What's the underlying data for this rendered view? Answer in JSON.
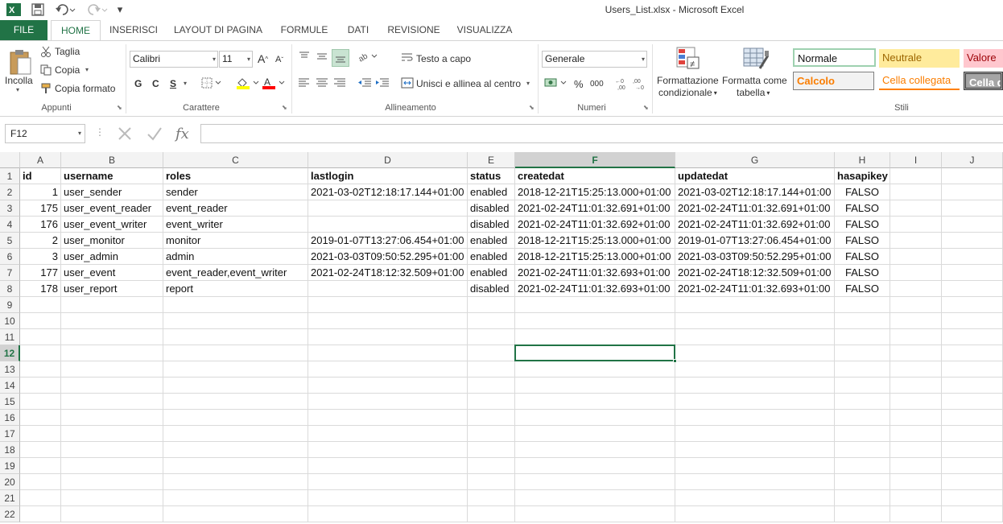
{
  "window": {
    "title": "Users_List.xlsx - Microsoft Excel"
  },
  "quick_access": {
    "more": "▾"
  },
  "tabs": [
    "FILE",
    "HOME",
    "INSERISCI",
    "LAYOUT DI PAGINA",
    "FORMULE",
    "DATI",
    "REVISIONE",
    "VISUALIZZA"
  ],
  "ribbon": {
    "clipboard": {
      "paste": "Incolla",
      "cut": "Taglia",
      "copy": "Copia",
      "format_painter": "Copia formato",
      "label": "Appunti"
    },
    "font": {
      "name": "Calibri",
      "size": "11",
      "bold": "G",
      "italic": "C",
      "underline": "S",
      "grow": "A",
      "shrink": "A",
      "label": "Carattere"
    },
    "alignment": {
      "wrap": "Testo a capo",
      "merge": "Unisci e allinea al centro",
      "label": "Allineamento"
    },
    "number": {
      "format": "Generale",
      "percent": "%",
      "thousands": "000",
      "label": "Numeri"
    },
    "styles": {
      "conditional_1": "Formattazione",
      "conditional_2": "condizionale",
      "table_1": "Formatta come",
      "table_2": "tabella",
      "normal": "Normale",
      "neutral": "Neutrale",
      "value": "Valore",
      "calc": "Calcolo",
      "linked": "Cella collegata",
      "check": "Cella da",
      "label": "Stili"
    }
  },
  "formula_bar": {
    "name_box": "F12",
    "fx": "fx",
    "value": ""
  },
  "sheet": {
    "columns": [
      "A",
      "B",
      "C",
      "D",
      "E",
      "F",
      "G",
      "H",
      "I",
      "J"
    ],
    "selected_column": "F",
    "selected_row": 12,
    "row_numbers": [
      "1",
      "2",
      "3",
      "4",
      "5",
      "6",
      "7",
      "8",
      "9",
      "10",
      "11",
      "12",
      "13",
      "14",
      "15",
      "16",
      "17",
      "18",
      "19",
      "20",
      "21",
      "22"
    ],
    "header": [
      "id",
      "username",
      "roles",
      "lastlogin",
      "status",
      "createdat",
      "updatedat",
      "hasapikey"
    ],
    "rows": [
      [
        "1",
        "user_sender",
        "sender",
        "2021-03-02T12:18:17.144+01:00",
        "enabled",
        "2018-12-21T15:25:13.000+01:00",
        "2021-03-02T12:18:17.144+01:00",
        "FALSO"
      ],
      [
        "175",
        "user_event_reader",
        "event_reader",
        "",
        "disabled",
        "2021-02-24T11:01:32.691+01:00",
        "2021-02-24T11:01:32.691+01:00",
        "FALSO"
      ],
      [
        "176",
        "user_event_writer",
        "event_writer",
        "",
        "disabled",
        "2021-02-24T11:01:32.692+01:00",
        "2021-02-24T11:01:32.692+01:00",
        "FALSO"
      ],
      [
        "2",
        "user_monitor",
        "monitor",
        "2019-01-07T13:27:06.454+01:00",
        "enabled",
        "2018-12-21T15:25:13.000+01:00",
        "2019-01-07T13:27:06.454+01:00",
        "FALSO"
      ],
      [
        "3",
        "user_admin",
        "admin",
        "2021-03-03T09:50:52.295+01:00",
        "enabled",
        "2018-12-21T15:25:13.000+01:00",
        "2021-03-03T09:50:52.295+01:00",
        "FALSO"
      ],
      [
        "177",
        "user_event",
        "event_reader,event_writer",
        "2021-02-24T18:12:32.509+01:00",
        "enabled",
        "2021-02-24T11:01:32.693+01:00",
        "2021-02-24T18:12:32.509+01:00",
        "FALSO"
      ],
      [
        "178",
        "user_report",
        "report",
        "",
        "disabled",
        "2021-02-24T11:01:32.693+01:00",
        "2021-02-24T11:01:32.693+01:00",
        "FALSO"
      ]
    ]
  },
  "colors": {
    "excel_green": "#217346",
    "neutral_bg": "#ffeb9c",
    "neutral_fg": "#9c6500",
    "bad_bg": "#ffc7ce",
    "bad_fg": "#9c0006",
    "calc_fg": "#fa7d00",
    "check_bg": "#a5a5a5"
  }
}
